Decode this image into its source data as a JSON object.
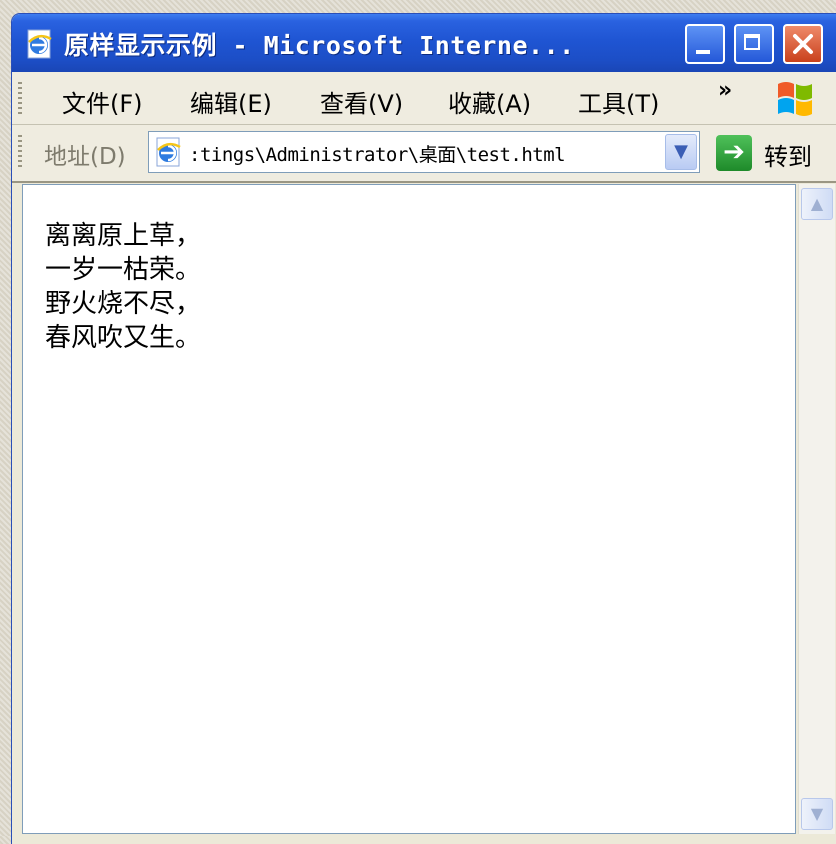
{
  "window": {
    "title": "原样显示示例 - Microsoft Interne..."
  },
  "menubar": {
    "items": [
      {
        "label": "文件(F)"
      },
      {
        "label": "编辑(E)"
      },
      {
        "label": "查看(V)"
      },
      {
        "label": "收藏(A)"
      },
      {
        "label": "工具(T)"
      }
    ],
    "overflow": "»"
  },
  "addressbar": {
    "label": "地址(D)",
    "url": ":tings\\Administrator\\桌面\\test.html",
    "go_label": "转到"
  },
  "content": {
    "poem": "离离原上草，\n一岁一枯荣。\n野火烧不尽，\n春风吹又生。"
  },
  "colors": {
    "titlebar": "#1f55d3",
    "close_button": "#c9411c",
    "go_button": "#1e8a2a"
  },
  "icons": [
    "ie-page-icon",
    "minimize-icon",
    "maximize-icon",
    "close-icon",
    "windows-logo-icon",
    "dropdown-arrow-icon",
    "go-arrow-icon",
    "scroll-up-icon",
    "scroll-down-icon"
  ]
}
